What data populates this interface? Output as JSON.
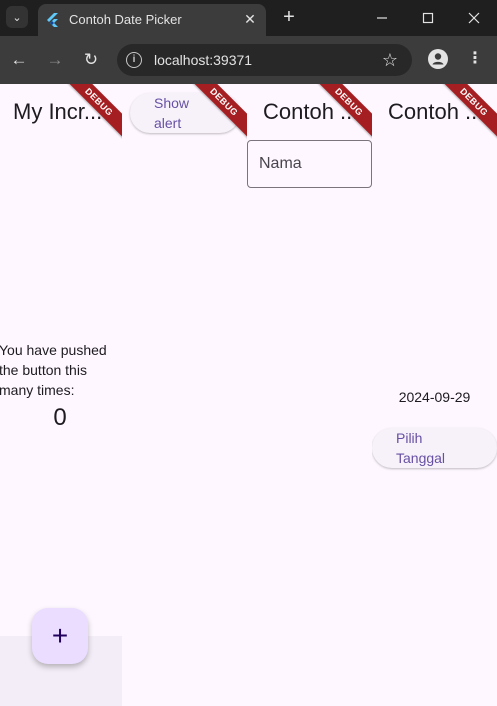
{
  "browser": {
    "tab_title": "Contoh Date Picker",
    "url": "localhost:39371"
  },
  "panes": [
    {
      "title": "My Incr...",
      "counter_label": "You have pushed\nthe button this\nmany times:",
      "counter_value": "0",
      "fab_label": "+"
    },
    {
      "alert_button_label": "Show\nalert"
    },
    {
      "title": "Contoh ...",
      "name_placeholder": "Nama"
    },
    {
      "title": "Contoh ...",
      "date_value": "2024-09-29",
      "pick_button_label": "Pilih\nTanggal"
    }
  ],
  "debug_banner": "DEBUG",
  "colors": {
    "banner": "#a51f22",
    "primary": "#6750a4",
    "fab_bg": "#eaddff",
    "surface": "#fef7ff"
  }
}
